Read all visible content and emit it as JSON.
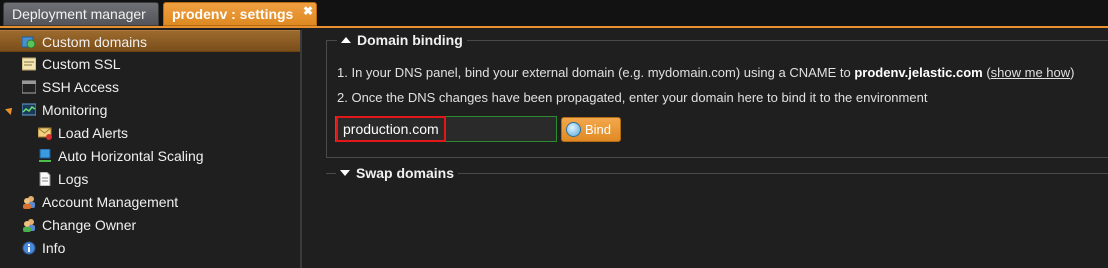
{
  "tabs": [
    {
      "label": "Deployment manager"
    },
    {
      "label": "prodenv : settings",
      "close": "✖"
    }
  ],
  "sidebar": {
    "items": [
      {
        "label": "Custom domains",
        "icon": "globe-icon"
      },
      {
        "label": "Custom SSL",
        "icon": "certificate-icon"
      },
      {
        "label": "SSH Access",
        "icon": "terminal-icon"
      },
      {
        "label": "Monitoring",
        "icon": "monitor-chart-icon"
      },
      {
        "label": "Load Alerts",
        "icon": "envelope-alert-icon"
      },
      {
        "label": "Auto Horizontal Scaling",
        "icon": "scaling-icon"
      },
      {
        "label": "Logs",
        "icon": "document-icon"
      },
      {
        "label": "Account Management",
        "icon": "users-icon"
      },
      {
        "label": "Change Owner",
        "icon": "users-icon"
      },
      {
        "label": "Info",
        "icon": "info-icon"
      }
    ]
  },
  "domain_binding": {
    "title": "Domain binding",
    "step1_prefix": "1. In your DNS panel, bind your external domain (e.g. mydomain.com) using a CNAME to ",
    "step1_host": "prodenv.jelastic.com",
    "step1_open": " (",
    "step1_link": "show me how",
    "step1_close": ")",
    "step2": "2. Once the DNS changes have been propagated, enter your domain here to bind it to the environment",
    "input_value": "production.com",
    "bind_label": "Bind"
  },
  "swap_domains": {
    "title": "Swap domains"
  },
  "colors": {
    "accent": "#e8902e",
    "highlight": "#e01818",
    "input_border": "#2e8a2e"
  }
}
